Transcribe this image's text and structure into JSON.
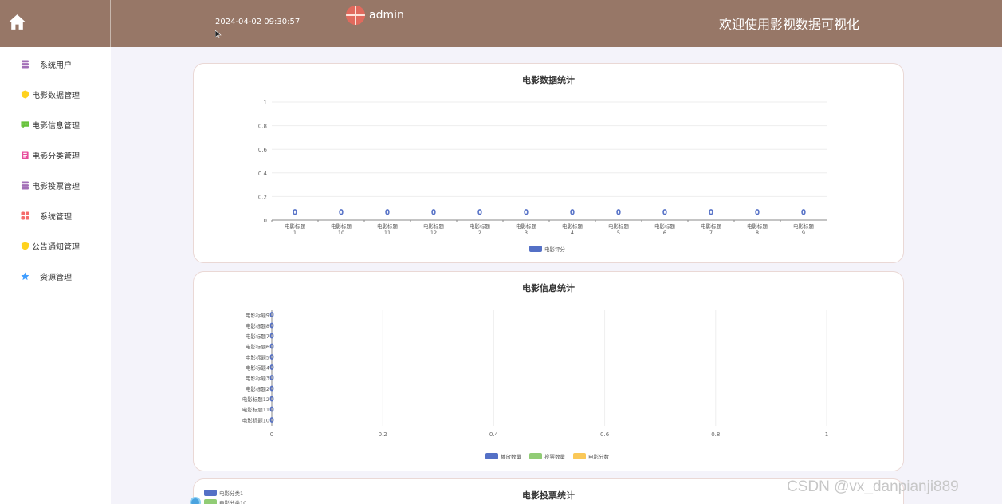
{
  "header": {
    "datetime": "2024-04-02 09:30:57",
    "username": "admin",
    "welcome": "欢迎使用影视数据可视化",
    "bg_color": "#977767"
  },
  "sidebar": {
    "items": [
      {
        "label": "系统用户",
        "icon": "database-icon",
        "color": "#a26fb7"
      },
      {
        "label": "电影数据管理",
        "icon": "shield-icon",
        "color": "#ffd21e"
      },
      {
        "label": "电影信息管理",
        "icon": "message-icon",
        "color": "#67c23a"
      },
      {
        "label": "电影分类管理",
        "icon": "document-icon",
        "color": "#e74c9c"
      },
      {
        "label": "电影投票管理",
        "icon": "database-icon",
        "color": "#a26fb7"
      },
      {
        "label": "系统管理",
        "icon": "grid-icon",
        "color": "#f56c6c"
      },
      {
        "label": "公告通知管理",
        "icon": "shield-icon",
        "color": "#ffd21e"
      },
      {
        "label": "资源管理",
        "icon": "star-icon",
        "color": "#409eff"
      }
    ]
  },
  "cards": {
    "card1_title": "电影数据统计",
    "card2_title": "电影信息统计",
    "card3_title": "电影投票统计"
  },
  "chart_data": [
    {
      "type": "bar",
      "title": "电影数据统计",
      "categories": [
        "电影标题1",
        "电影标题10",
        "电影标题11",
        "电影标题12",
        "电影标题2",
        "电影标题3",
        "电影标题4",
        "电影标题5",
        "电影标题6",
        "电影标题7",
        "电影标题8",
        "电影标题9"
      ],
      "category_lines": [
        [
          "电影标题",
          "1"
        ],
        [
          "电影标题",
          "10"
        ],
        [
          "电影标题",
          "11"
        ],
        [
          "电影标题",
          "12"
        ],
        [
          "电影标题",
          "2"
        ],
        [
          "电影标题",
          "3"
        ],
        [
          "电影标题",
          "4"
        ],
        [
          "电影标题",
          "5"
        ],
        [
          "电影标题",
          "6"
        ],
        [
          "电影标题",
          "7"
        ],
        [
          "电影标题",
          "8"
        ],
        [
          "电影标题",
          "9"
        ]
      ],
      "series": [
        {
          "name": "电影评分",
          "values": [
            0,
            0,
            0,
            0,
            0,
            0,
            0,
            0,
            0,
            0,
            0,
            0
          ],
          "color": "#5470c6"
        }
      ],
      "ylim": [
        0,
        1
      ],
      "yticks": [
        "0",
        "0.2",
        "0.4",
        "0.6",
        "0.8",
        "1"
      ],
      "legend": "bottom-center",
      "grid": true
    },
    {
      "type": "bar",
      "orientation": "horizontal",
      "title": "电影信息统计",
      "categories": [
        "电影标题10",
        "电影标题11",
        "电影标题12",
        "电影标题2",
        "电影标题3",
        "电影标题4",
        "电影标题5",
        "电影标题6",
        "电影标题7",
        "电影标题8",
        "电影标题9"
      ],
      "series": [
        {
          "name": "播放数量",
          "values": [
            0,
            0,
            0,
            0,
            0,
            0,
            0,
            0,
            0,
            0,
            0
          ],
          "color": "#5470c6"
        },
        {
          "name": "投票数量",
          "values": [
            0,
            0,
            0,
            0,
            0,
            0,
            0,
            0,
            0,
            0,
            0
          ],
          "color": "#91cc75"
        },
        {
          "name": "电影分数",
          "values": [
            0,
            0,
            0,
            0,
            0,
            0,
            0,
            0,
            0,
            0,
            0
          ],
          "color": "#fac858"
        }
      ],
      "xlim": [
        0,
        1
      ],
      "xticks": [
        "0",
        "0.2",
        "0.4",
        "0.6",
        "0.8",
        "1"
      ],
      "legend": "bottom-center",
      "grid": true
    },
    {
      "type": "pie",
      "title": "电影投票统计",
      "legend_items": [
        {
          "name": "电影分类1",
          "color": "#5470c6"
        },
        {
          "name": "电影分类10",
          "color": "#91cc75"
        }
      ],
      "legend": "top-left"
    }
  ],
  "watermark": "CSDN @vx_danpianji889"
}
